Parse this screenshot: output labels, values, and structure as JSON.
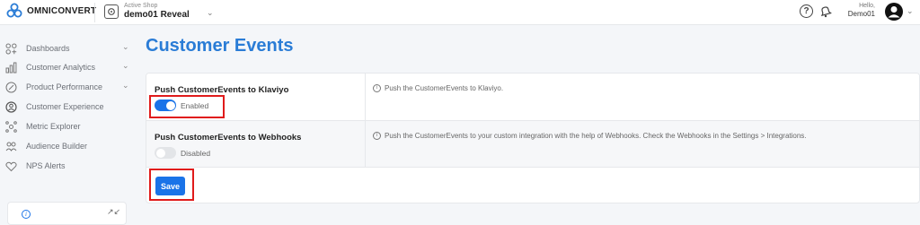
{
  "header": {
    "brand": "OMNICONVERT",
    "active_shop_label": "Active Shop",
    "active_shop_name": "demo01 Reveal",
    "help_symbol": "?",
    "greeting": "Hello,",
    "username": "Demo01"
  },
  "sidebar": {
    "items": [
      {
        "label": "Dashboards",
        "icon": "dashboards-icon",
        "has_chevron": true
      },
      {
        "label": "Customer Analytics",
        "icon": "analytics-icon",
        "has_chevron": true
      },
      {
        "label": "Product Performance",
        "icon": "performance-icon",
        "has_chevron": true
      },
      {
        "label": "Customer Experience",
        "icon": "experience-icon",
        "has_chevron": false
      },
      {
        "label": "Metric Explorer",
        "icon": "metric-explorer-icon",
        "has_chevron": false
      },
      {
        "label": "Audience Builder",
        "icon": "audience-icon",
        "has_chevron": false
      },
      {
        "label": "NPS Alerts",
        "icon": "nps-alerts-icon",
        "has_chevron": false
      }
    ]
  },
  "main": {
    "title": "Customer Events",
    "settings": [
      {
        "title": "Push CustomerEvents to Klaviyo",
        "toggle_state": "on",
        "toggle_label": "Enabled",
        "description": "Push the CustomerEvents to Klaviyo."
      },
      {
        "title": "Push CustomerEvents to Webhooks",
        "toggle_state": "off",
        "toggle_label": "Disabled",
        "description": "Push the CustomerEvents to your custom integration with the help of Webhooks. Check the Webhooks in the Settings > Integrations."
      }
    ],
    "save_label": "Save"
  },
  "colors": {
    "accent": "#1a73e8",
    "title": "#2a7cd6",
    "highlight": "#e01b1b",
    "logo": "#2a7cd6"
  }
}
